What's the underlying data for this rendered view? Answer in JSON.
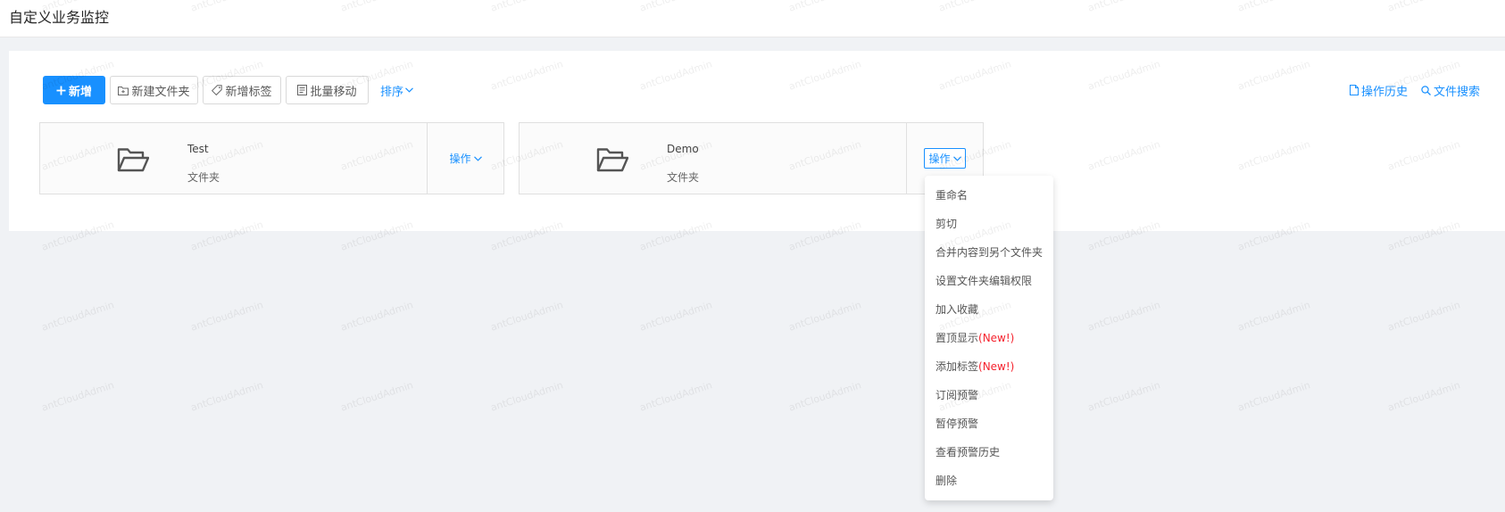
{
  "page": {
    "title": "自定义业务监控"
  },
  "toolbar": {
    "new_label": "新增",
    "new_folder_label": "新建文件夹",
    "new_tag_label": "新增标签",
    "batch_move_label": "批量移动",
    "sort_label": "排序"
  },
  "header_links": {
    "history_label": "操作历史",
    "search_label": "文件搜索"
  },
  "cards": [
    {
      "name": "Test",
      "type": "文件夹",
      "action_label": "操作"
    },
    {
      "name": "Demo",
      "type": "文件夹",
      "action_label": "操作"
    }
  ],
  "dropdown": {
    "items": [
      {
        "label": "重命名",
        "tag": ""
      },
      {
        "label": "剪切",
        "tag": ""
      },
      {
        "label": "合并内容到另个文件夹",
        "tag": ""
      },
      {
        "label": "设置文件夹编辑权限",
        "tag": ""
      },
      {
        "label": "加入收藏",
        "tag": ""
      },
      {
        "label": "置顶显示",
        "tag": "(New!)"
      },
      {
        "label": "添加标签",
        "tag": "(New!)"
      },
      {
        "label": "订阅预警",
        "tag": ""
      },
      {
        "label": "暂停预警",
        "tag": ""
      },
      {
        "label": "查看预警历史",
        "tag": ""
      },
      {
        "label": "删除",
        "tag": ""
      }
    ]
  },
  "watermark_text": "antCloudAdmin",
  "colors": {
    "primary": "#1890ff",
    "new_tag": "#f5222d",
    "background": "#f0f2f5"
  }
}
